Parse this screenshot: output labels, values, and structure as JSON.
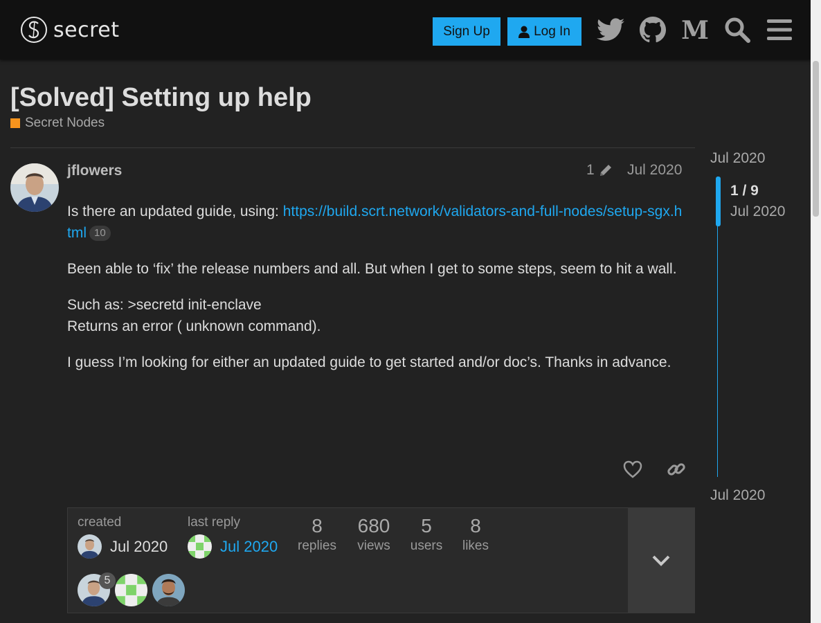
{
  "header": {
    "logo_text": "secret",
    "signup_label": "Sign Up",
    "login_label": "Log In",
    "icons": [
      "twitter-icon",
      "github-icon",
      "medium-icon",
      "search-icon",
      "menu-icon"
    ]
  },
  "topic": {
    "title": "[Solved] Setting up help",
    "category": "Secret Nodes",
    "category_color": "#f7941d"
  },
  "post": {
    "username": "jflowers",
    "edit_count": "1",
    "date": "Jul 2020",
    "para1_text": "Is there an updated guide, using: ",
    "para1_link": "https://build.scrt.network/validators-and-full-nodes/setup-sgx.html",
    "para1_link_clicks": "10",
    "para2": "Been able to ‘fix’ the release numbers and all. But when I get to some steps, seem to hit a wall.",
    "para3_line1": "Such as: >secretd init-enclave",
    "para3_line2": "Returns an error ( unknown command).",
    "para4": "I guess I’m looking for either an updated guide to get started and/or doc’s. Thanks in advance."
  },
  "topic_map": {
    "created_label": "created",
    "created_date": "Jul 2020",
    "last_reply_label": "last reply",
    "last_reply_date": "Jul 2020",
    "replies": "8",
    "replies_label": "replies",
    "views": "680",
    "views_label": "views",
    "users": "5",
    "users_label": "users",
    "likes": "8",
    "likes_label": "likes",
    "participant_post_count": "5"
  },
  "timeline": {
    "start_date": "Jul 2020",
    "position": "1 / 9",
    "position_date": "Jul 2020",
    "end_date": "Jul 2020"
  },
  "colors": {
    "accent": "#1fa8f0",
    "background": "#222222",
    "header": "#111111"
  }
}
